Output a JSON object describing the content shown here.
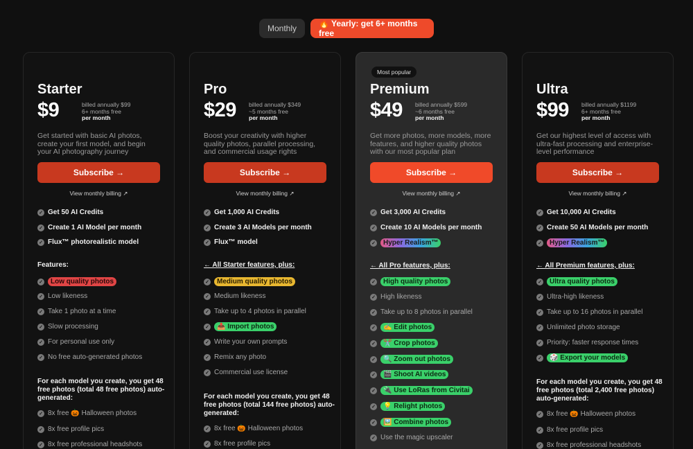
{
  "toggle": {
    "monthly": "Monthly",
    "yearly": "🔥 Yearly: get 6+ months free"
  },
  "cards": [
    {
      "name": "Starter",
      "price": "$9",
      "billing1": "billed annually $99",
      "billing2": "6+ months free",
      "billing3": "per month",
      "desc": "Get started with basic AI photos, create your first model, and begin your AI photography journey",
      "subscribe": "Subscribe →",
      "monthly_link": "View monthly billing ↗",
      "core": [
        "Get 50 AI Credits",
        "Create 1 AI Model per month",
        "Flux™ photorealistic model"
      ],
      "features_heading": "Features:",
      "features": [
        "Low quality photos",
        "Low likeness",
        "Take 1 photo at a time",
        "Slow processing",
        "For personal use only",
        "No free auto-generated photos"
      ],
      "auto_text": "For each model you create, you get 48 free photos (total 48 free photos) auto-generated:",
      "auto_items": [
        "8x free 🎃 Halloween photos",
        "8x free profile pics",
        "8x free professional headshots"
      ]
    },
    {
      "name": "Pro",
      "price": "$29",
      "billing1": "billed annually $349",
      "billing2": "~5 months free",
      "billing3": "per month",
      "desc": "Boost your creativity with higher quality photos, parallel processing, and commercial usage rights",
      "subscribe": "Subscribe →",
      "monthly_link": "View monthly billing ↗",
      "core": [
        "Get 1,000 AI Credits",
        "Create 3 AI Models per month",
        "Flux™ model"
      ],
      "features_heading": "← All Starter features, plus:",
      "features": [
        "Medium quality photos",
        "Medium likeness",
        "Take up to 4 photos in parallel",
        "📤 Import photos",
        "Write your own prompts",
        "Remix any photo",
        "Commercial use license"
      ],
      "auto_text": "For each model you create, you get 48 free photos (total 144 free photos) auto-generated:",
      "auto_items": [
        "8x free 🎃 Halloween photos",
        "8x free profile pics"
      ]
    },
    {
      "badge": "Most popular",
      "name": "Premium",
      "price": "$49",
      "billing1": "billed annually $599",
      "billing2": "~6 months free",
      "billing3": "per month",
      "desc": "Get more photos, more models, more features, and higher quality photos with our most popular plan",
      "subscribe": "Subscribe →",
      "monthly_link": "View monthly billing ↗",
      "core": [
        "Get 3,000 AI Credits",
        "Create 10 AI Models per month",
        "Hyper Realism™"
      ],
      "features_heading": "← All Pro features, plus:",
      "features": [
        "High quality photos",
        "High likeness",
        "Take up to 8 photos in parallel",
        "✍️ Edit photos",
        "✂️ Crop photos",
        "🔍 Zoom out photos",
        "🎬 Shoot AI videos",
        "🔌 Use LoRas from Civitai",
        "💡 Relight photos",
        "🖼️ Combine photos",
        "Use the magic upscaler"
      ]
    },
    {
      "name": "Ultra",
      "price": "$99",
      "billing1": "billed annually $1199",
      "billing2": "6+ months free",
      "billing3": "per month",
      "desc": "Get our highest level of access with ultra-fast processing and enterprise-level performance",
      "subscribe": "Subscribe →",
      "monthly_link": "View monthly billing ↗",
      "core": [
        "Get 10,000 AI Credits",
        "Create 50 AI Models per month",
        "Hyper Realism™"
      ],
      "features_heading": "← All Premium features, plus:",
      "features": [
        "Ultra quality photos",
        "Ultra-high likeness",
        "Take up to 16 photos in parallel",
        "Unlimited photo storage",
        "Priority: faster response times",
        "🎲 Export your models"
      ],
      "auto_text": "For each model you create, you get 48 free photos (total 2,400 free photos) auto-generated:",
      "auto_items": [
        "8x free 🎃 Halloween photos",
        "8x free profile pics",
        "8x free professional headshots"
      ]
    }
  ]
}
